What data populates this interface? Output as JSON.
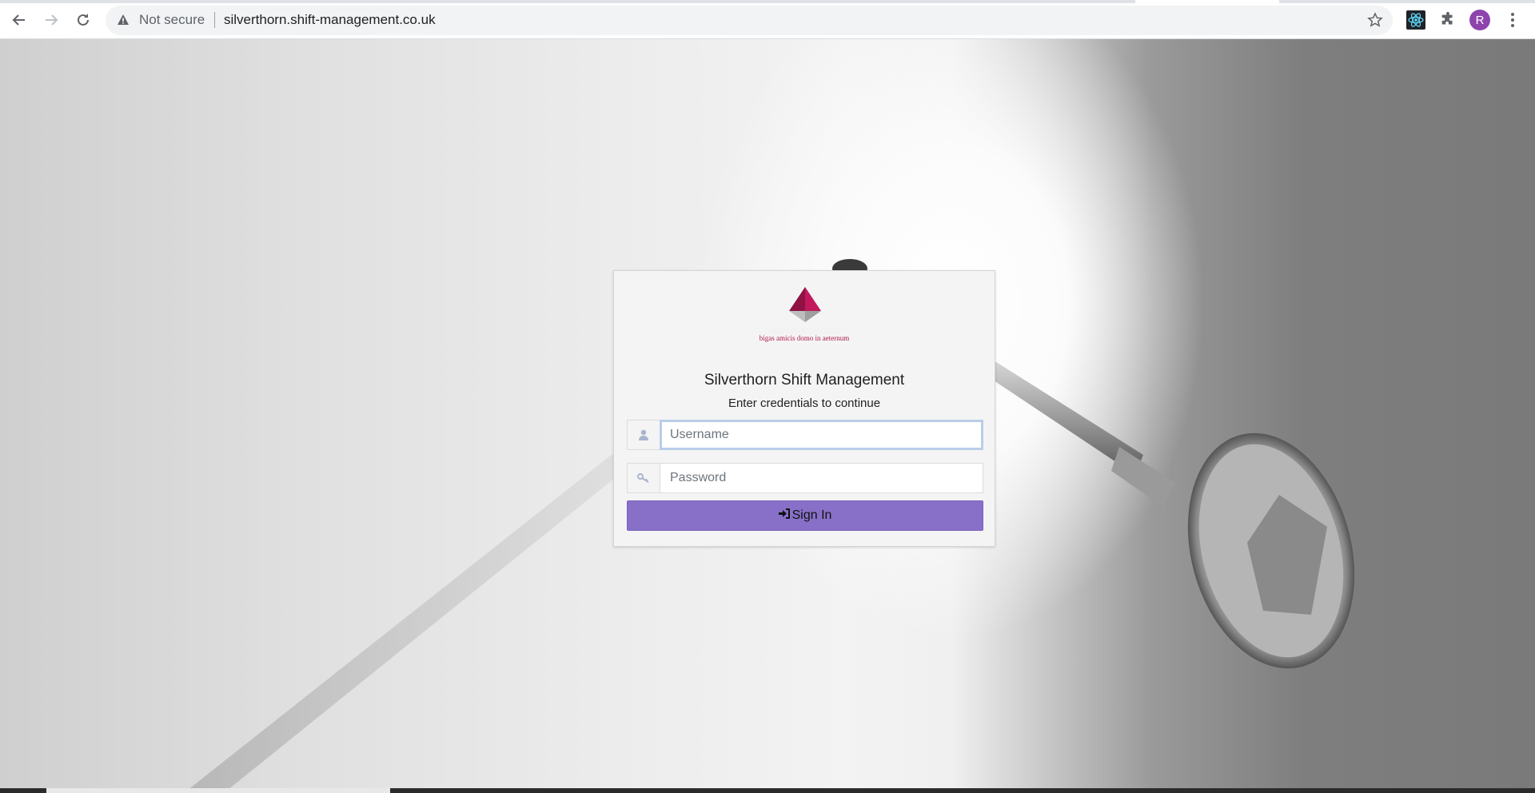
{
  "browser": {
    "security_label": "Not secure",
    "url": "silverthorn.shift-management.co.uk",
    "avatar_letter": "R",
    "icons": [
      "back-arrow-icon",
      "forward-arrow-icon",
      "reload-icon",
      "warning-icon",
      "star-icon",
      "react-devtools-icon",
      "extensions-puzzle-icon",
      "kebab-menu-icon"
    ]
  },
  "login": {
    "logo_tagline": "bigas amicis domo in aeternum",
    "title": "Silverthorn Shift Management",
    "subtitle": "Enter credentials to continue",
    "username_placeholder": "Username",
    "password_placeholder": "Password",
    "signin_label": "Sign In",
    "accent_color": "#8870c8",
    "logo_color": "#b0184a"
  }
}
